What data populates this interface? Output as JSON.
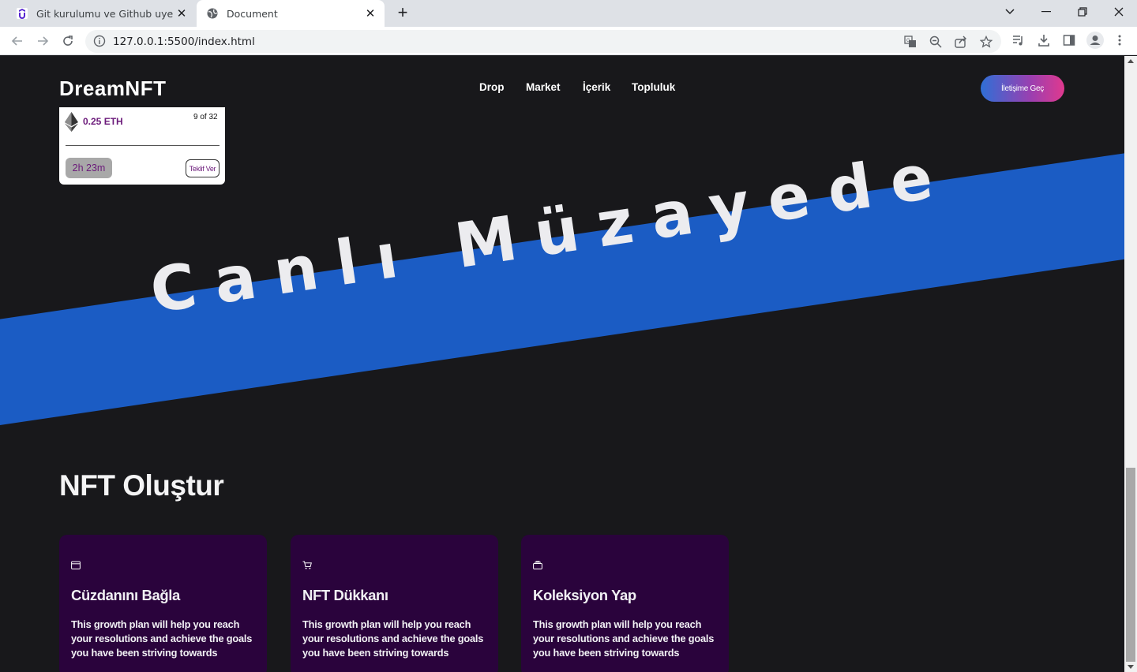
{
  "browser": {
    "tabs": [
      {
        "title": "Git kurulumu ve Github uyelik | Ud",
        "active": false
      },
      {
        "title": "Document",
        "active": true
      }
    ],
    "url": "127.0.0.1:5500/index.html"
  },
  "site": {
    "logo": "DreamNFT",
    "nav": [
      "Drop",
      "Market",
      "İçerik",
      "Topluluk"
    ],
    "contact_button": "İletişime Geç"
  },
  "auction_card": {
    "price": "0.25 ETH",
    "edition": "9 of 32",
    "timer": "2h 23m",
    "bid_button": "Teklif Ver"
  },
  "banner": {
    "text": "Canlı Müzayede",
    "color": "#1b5cc4"
  },
  "create_section": {
    "title": "NFT Oluştur",
    "cards": [
      {
        "icon": "wallet-icon",
        "title": "Cüzdanını Bağla",
        "description": "This growth plan will help you reach your resolutions and achieve the goals you have been striving towards"
      },
      {
        "icon": "cart-icon",
        "title": "NFT Dükkanı",
        "description": "This growth plan will help you reach your resolutions and achieve the goals you have been striving towards"
      },
      {
        "icon": "collection-icon",
        "title": "Koleksiyon Yap",
        "description": "This growth plan will help you reach your resolutions and achieve the goals you have been striving towards"
      }
    ]
  }
}
